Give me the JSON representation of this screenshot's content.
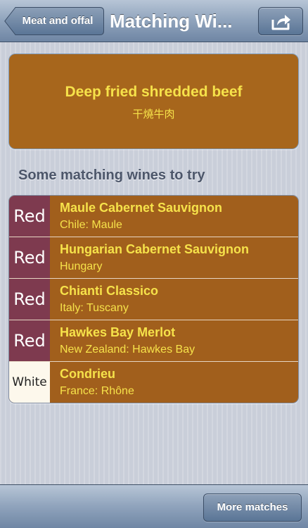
{
  "navbar": {
    "back_label": "Meat and offal",
    "title": "Matching Wi...",
    "share_icon": "share-icon"
  },
  "dish": {
    "name": "Deep fried shredded beef",
    "name_cn": "干燒牛肉"
  },
  "section_heading": "Some matching wines to try",
  "wines": [
    {
      "color": "Red",
      "name": "Maule Cabernet Sauvignon",
      "region": "Chile: Maule"
    },
    {
      "color": "Red",
      "name": "Hungarian Cabernet Sauvignon",
      "region": "Hungary"
    },
    {
      "color": "Red",
      "name": "Chianti Classico",
      "region": "Italy: Tuscany"
    },
    {
      "color": "Red",
      "name": "Hawkes Bay Merlot",
      "region": "New Zealand: Hawkes Bay"
    },
    {
      "color": "White",
      "name": "Condrieu",
      "region": "France: Rhône"
    }
  ],
  "toolbar": {
    "more_label": "More matches"
  },
  "colors": {
    "card_brown": "#a7661c",
    "text_yellow": "#f6e24a",
    "red_wine": "#7e3a4f",
    "white_wine": "#fdf8ec"
  }
}
